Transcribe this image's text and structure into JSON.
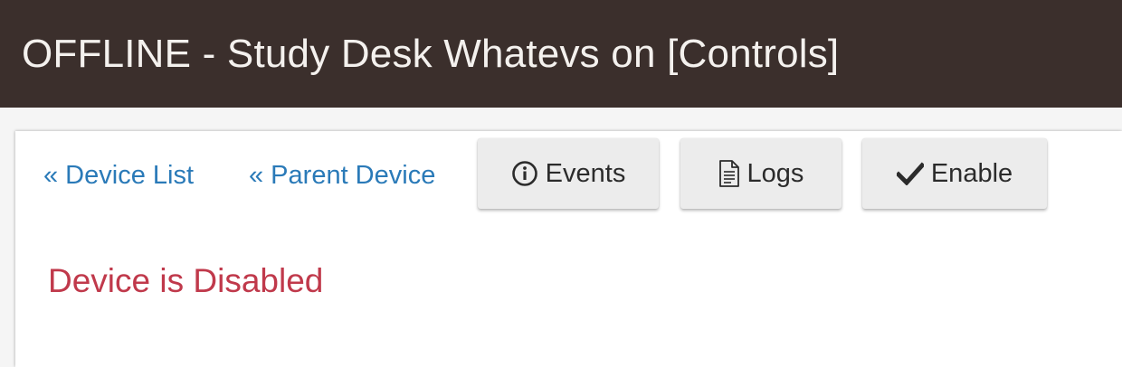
{
  "header": {
    "title": "OFFLINE - Study Desk Whatevs on [Controls]"
  },
  "nav": {
    "device_list": "« Device List",
    "parent_device": "« Parent Device"
  },
  "toolbar": {
    "events_label": "Events",
    "events_icon": "info-circle-icon",
    "logs_label": "Logs",
    "logs_icon": "document-icon",
    "enable_label": "Enable",
    "enable_icon": "checkmark-icon"
  },
  "status": {
    "message": "Device is Disabled"
  },
  "colors": {
    "header_bg": "#3b2f2c",
    "link": "#2a7ab8",
    "error": "#c0394b",
    "button_bg": "#ececec"
  }
}
